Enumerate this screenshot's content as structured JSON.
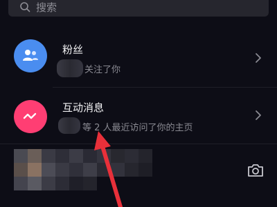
{
  "search": {
    "placeholder": "搜索"
  },
  "notifications": [
    {
      "title": "粉丝",
      "subtitle": "关注了你"
    },
    {
      "title": "互动消息",
      "subtitle": "等 2 人最近访问了你的主页"
    }
  ],
  "colors": {
    "fans_avatar": "#4a8df0",
    "interaction_avatar": "#ff3e73",
    "annotation_arrow": "#e8303a"
  },
  "icons": [
    "search-icon",
    "fans-icon",
    "interaction-icon",
    "chevron-right-icon",
    "camera-icon"
  ]
}
